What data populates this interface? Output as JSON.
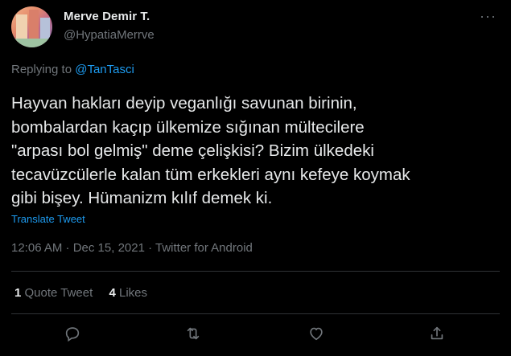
{
  "author": {
    "name": "Merve Demir T.",
    "handle": "@HypatiaMerrve"
  },
  "menu": {
    "more_label": "···"
  },
  "reply": {
    "prefix": "Replying to ",
    "to": "@TanTasci"
  },
  "tweet": {
    "text": "Hayvan hakları deyip veganlığı savunan birinin,\nbombalardan kaçıp ülkemize sığınan mültecilere\n\"arpası bol gelmiş\" deme çelişkisi? Bizim ülkedeki\ntecavüzcülerle kalan tüm erkekleri aynı kefeye koymak\ngibi bişey. Hümanizm kılıf demek ki.",
    "translate_label": "Translate Tweet",
    "meta": "12:06 AM · Dec 15, 2021 · Twitter for Android"
  },
  "stats": {
    "quote_count": "1",
    "quote_label": " Quote Tweet",
    "like_count": "4",
    "like_label": " Likes"
  },
  "actions": {
    "reply_icon": "reply-icon",
    "retweet_icon": "retweet-icon",
    "like_icon": "heart-icon",
    "share_icon": "share-icon"
  },
  "colors": {
    "background": "#000000",
    "text": "#e7e9ea",
    "secondary": "#71767b",
    "accent": "#1d9bf0",
    "divider": "#2f3336"
  }
}
